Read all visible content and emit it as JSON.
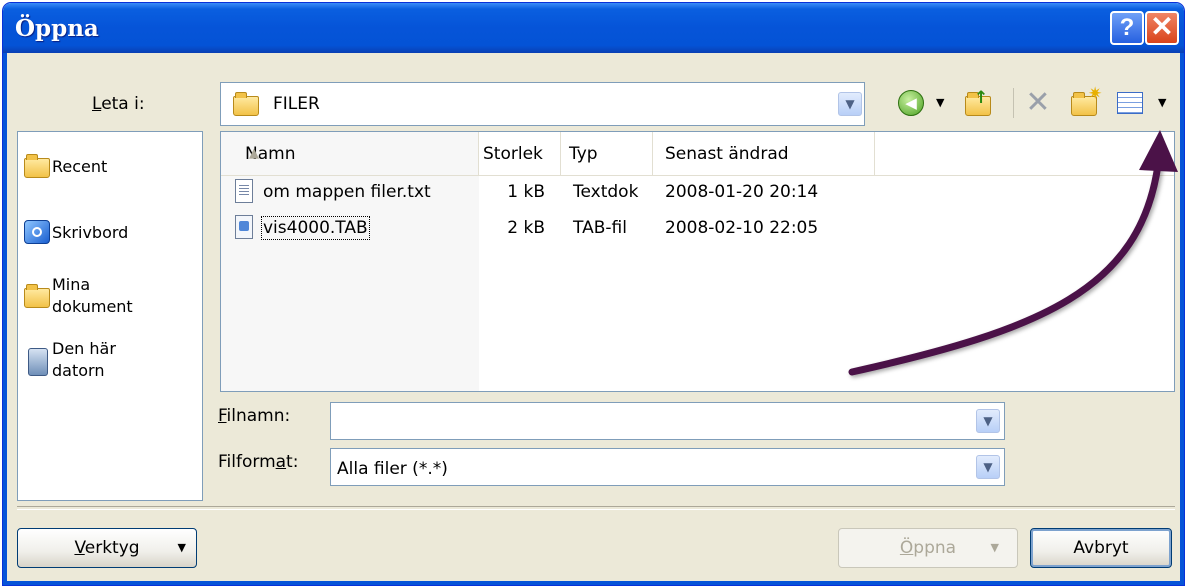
{
  "dialog": {
    "title": "Öppna"
  },
  "titlebar": {
    "help_glyph": "?",
    "close_glyph": "✕"
  },
  "lookin": {
    "label_accel": "L",
    "label_rest": "eta i:",
    "value": "FILER",
    "icon": "folder-icon"
  },
  "toolbar": {
    "icons": [
      "back-icon",
      "up-folder-icon",
      "delete-icon",
      "new-folder-icon",
      "views-icon"
    ]
  },
  "places": [
    {
      "label": "Recent",
      "icon": "recent-folder-icon"
    },
    {
      "label": "Skrivbord",
      "icon": "desktop-icon"
    },
    {
      "line1": "Mina",
      "line2": "dokument",
      "icon": "documents-folder-icon"
    },
    {
      "line1": "Den här",
      "line2": "datorn",
      "icon": "computer-icon"
    }
  ],
  "filelist": {
    "columns": {
      "name": "Namn",
      "size": "Storlek",
      "type": "Typ",
      "modified": "Senast ändrad"
    },
    "rows": [
      {
        "name": "om mappen filer.txt",
        "size": "1 kB",
        "type": "Textdok",
        "modified": "2008-01-20 20:14",
        "icon": "text-file-icon"
      },
      {
        "name": "vis4000.TAB",
        "size": "2 kB",
        "type": "TAB-fil",
        "modified": "2008-02-10 22:05",
        "icon": "tab-file-icon"
      }
    ]
  },
  "filename": {
    "label_accel": "F",
    "label_rest": "ilnamn:",
    "value": ""
  },
  "fileformat": {
    "label_pre": "Filform",
    "label_accel": "a",
    "label_post": "t:",
    "value": "Alla filer (*.*)"
  },
  "buttons": {
    "tools_accel": "V",
    "tools_rest": "erktyg",
    "open_accel": "Ö",
    "open_rest": "ppna",
    "cancel": "Avbryt"
  },
  "annotation": {
    "arrow_color": "#4b1248"
  }
}
